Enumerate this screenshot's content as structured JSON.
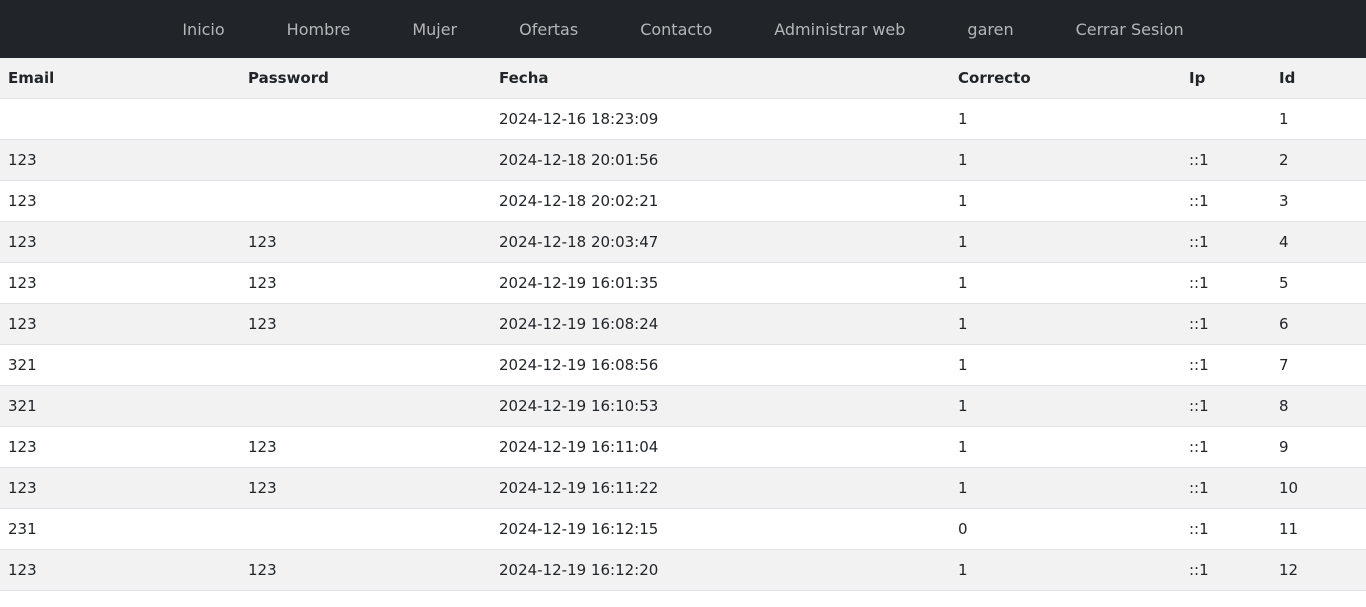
{
  "nav": {
    "items": [
      {
        "label": "Inicio"
      },
      {
        "label": "Hombre"
      },
      {
        "label": "Mujer"
      },
      {
        "label": "Ofertas"
      },
      {
        "label": "Contacto"
      },
      {
        "label": "Administrar web"
      },
      {
        "label": "garen"
      },
      {
        "label": "Cerrar Sesion"
      }
    ]
  },
  "table": {
    "headers": [
      "Email",
      "Password",
      "Fecha",
      "Correcto",
      "Ip",
      "Id"
    ],
    "rows": [
      [
        "",
        "",
        "2024-12-16 18:23:09",
        "1",
        "",
        "1"
      ],
      [
        "123",
        "",
        "2024-12-18 20:01:56",
        "1",
        "::1",
        "2"
      ],
      [
        "123",
        "",
        "2024-12-18 20:02:21",
        "1",
        "::1",
        "3"
      ],
      [
        "123",
        "123",
        "2024-12-18 20:03:47",
        "1",
        "::1",
        "4"
      ],
      [
        "123",
        "123",
        "2024-12-19 16:01:35",
        "1",
        "::1",
        "5"
      ],
      [
        "123",
        "123",
        "2024-12-19 16:08:24",
        "1",
        "::1",
        "6"
      ],
      [
        "321",
        "",
        "2024-12-19 16:08:56",
        "1",
        "::1",
        "7"
      ],
      [
        "321",
        "",
        "2024-12-19 16:10:53",
        "1",
        "::1",
        "8"
      ],
      [
        "123",
        "123",
        "2024-12-19 16:11:04",
        "1",
        "::1",
        "9"
      ],
      [
        "123",
        "123",
        "2024-12-19 16:11:22",
        "1",
        "::1",
        "10"
      ],
      [
        "231",
        "",
        "2024-12-19 16:12:15",
        "0",
        "::1",
        "11"
      ],
      [
        "123",
        "123",
        "2024-12-19 16:12:20",
        "1",
        "::1",
        "12"
      ]
    ]
  }
}
